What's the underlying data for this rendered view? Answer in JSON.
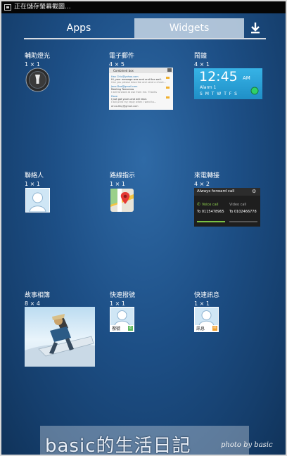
{
  "status_bar": {
    "text": "正在儲存螢幕截圖..."
  },
  "tabs": [
    {
      "label": "Apps"
    },
    {
      "label": "Widgets"
    }
  ],
  "widgets": [
    {
      "name": "輔助燈光",
      "size": "1 × 1"
    },
    {
      "name": "電子郵件",
      "size": "4 × 5"
    },
    {
      "name": "鬧鐘",
      "size": "4 × 1"
    },
    {
      "name": "聯絡人",
      "size": "1 × 1"
    },
    {
      "name": "路線指示",
      "size": "1 × 1"
    },
    {
      "name": "來電轉接",
      "size": "4 × 2"
    },
    {
      "name": "故事相簿",
      "size": "8 × 4"
    },
    {
      "name": "快速撥號",
      "size": "1 × 1"
    },
    {
      "name": "快速訊息",
      "size": "1 × 1"
    }
  ],
  "previews": {
    "email": {
      "header": "Combined box",
      "rows": [
        {
          "line1": "Han Chiu@yahoo.com",
          "line2": "Hi, your message was sent and fine well.",
          "line3": "Can you please describe and send a check..."
        },
        {
          "line1": "Jane.Doe@gmail.com",
          "line2": "Meeting Tomorrow",
          "line3": "I will forward at ask from me. Thanks"
        },
        {
          "line1": "Dave",
          "line2": "I just got yours and will read.",
          "line3": "I will print my reply when I want to..."
        }
      ],
      "footer": "Anna.Bay@gmail.com"
    },
    "alarm": {
      "time": "12:45",
      "ampm": "AM",
      "label": "Alarm 1",
      "days": "S M T W T F S"
    },
    "forward": {
      "title": "Always forward call",
      "voice_label": "Voice call",
      "voice_number": "To 0115478965",
      "video_label": "Video call",
      "video_number": "To 0102466778"
    },
    "direct_dial": {
      "label": "撥號"
    },
    "direct_message": {
      "label": "訊息"
    }
  },
  "watermark": {
    "text": "basic的生活日記",
    "signature": "photo by basic"
  },
  "icons": {
    "download": "download-icon",
    "flashlight": "flashlight-icon",
    "contact": "contact-avatar-icon",
    "maps": "maps-icon",
    "call": "call-icon",
    "message": "message-icon",
    "settings": "settings-icon"
  },
  "colors": {
    "accent": "#33b5e5",
    "tab_active": "#c8d7e6",
    "clock_bg": "#30a3d6"
  }
}
